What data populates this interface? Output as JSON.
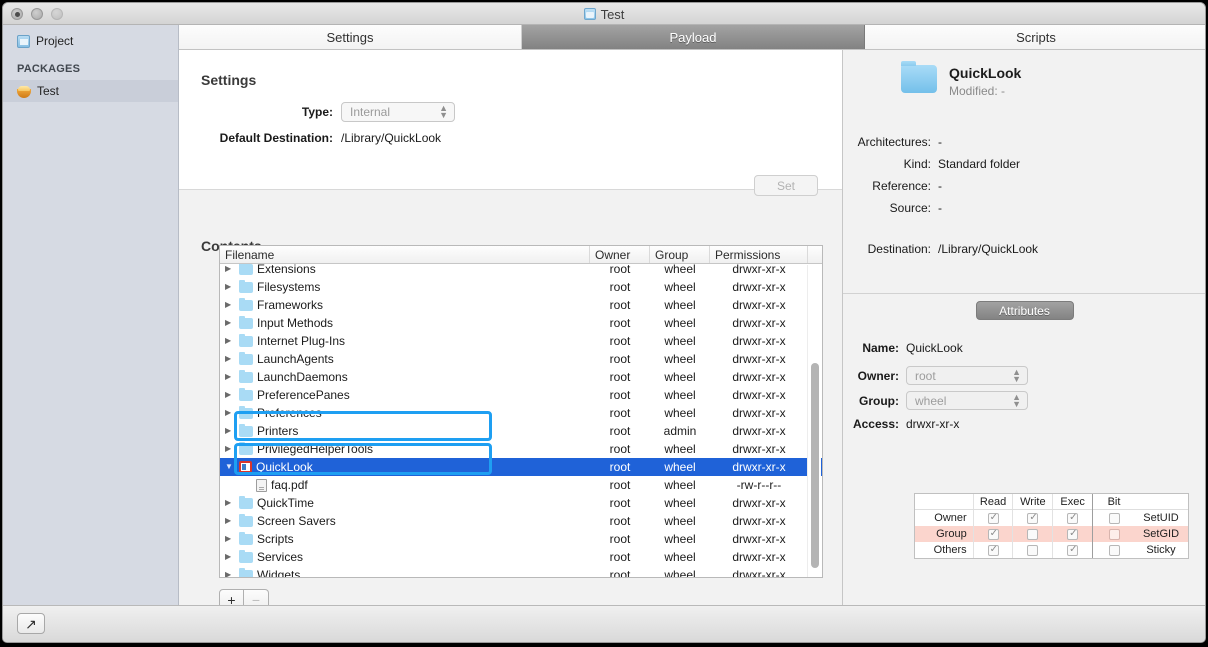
{
  "window": {
    "title": "Test",
    "title_icon": "project-document-icon",
    "controls": [
      "close-button",
      "minimize-button",
      "zoom-button"
    ]
  },
  "sidebar": {
    "items": [
      {
        "label": "Project",
        "icon": "project-icon",
        "selected": false
      },
      {
        "label": "Test",
        "icon": "package-icon",
        "selected": true
      }
    ],
    "section_header": "PACKAGES"
  },
  "tabs": [
    {
      "label": "Settings",
      "active": false
    },
    {
      "label": "Payload",
      "active": true
    },
    {
      "label": "Scripts",
      "active": false
    }
  ],
  "settings": {
    "title": "Settings",
    "type_label": "Type:",
    "type_value": "Internal",
    "destination_label": "Default Destination:",
    "destination_value": "/Library/QuickLook",
    "set_button": "Set"
  },
  "contents": {
    "title": "Contents",
    "columns": [
      "Filename",
      "Owner",
      "Group",
      "Permissions"
    ],
    "add_button": "+",
    "remove_button": "−",
    "rows": [
      {
        "name": "Extensions",
        "owner": "root",
        "group": "wheel",
        "perm": "drwxr-xr-x",
        "icon": "folder-icon",
        "disclosure": "closed",
        "indent": 0,
        "selected": false,
        "clipped": true
      },
      {
        "name": "Filesystems",
        "owner": "root",
        "group": "wheel",
        "perm": "drwxr-xr-x",
        "icon": "folder-icon",
        "disclosure": "closed",
        "indent": 0,
        "selected": false
      },
      {
        "name": "Frameworks",
        "owner": "root",
        "group": "wheel",
        "perm": "drwxr-xr-x",
        "icon": "folder-icon",
        "disclosure": "closed",
        "indent": 0,
        "selected": false
      },
      {
        "name": "Input Methods",
        "owner": "root",
        "group": "wheel",
        "perm": "drwxr-xr-x",
        "icon": "folder-icon",
        "disclosure": "closed",
        "indent": 0,
        "selected": false
      },
      {
        "name": "Internet Plug-Ins",
        "owner": "root",
        "group": "wheel",
        "perm": "drwxr-xr-x",
        "icon": "folder-icon",
        "disclosure": "closed",
        "indent": 0,
        "selected": false
      },
      {
        "name": "LaunchAgents",
        "owner": "root",
        "group": "wheel",
        "perm": "drwxr-xr-x",
        "icon": "folder-icon",
        "disclosure": "closed",
        "indent": 0,
        "selected": false
      },
      {
        "name": "LaunchDaemons",
        "owner": "root",
        "group": "wheel",
        "perm": "drwxr-xr-x",
        "icon": "folder-icon",
        "disclosure": "closed",
        "indent": 0,
        "selected": false
      },
      {
        "name": "PreferencePanes",
        "owner": "root",
        "group": "wheel",
        "perm": "drwxr-xr-x",
        "icon": "folder-icon",
        "disclosure": "closed",
        "indent": 0,
        "selected": false
      },
      {
        "name": "Preferences",
        "owner": "root",
        "group": "wheel",
        "perm": "drwxr-xr-x",
        "icon": "folder-icon",
        "disclosure": "closed",
        "indent": 0,
        "selected": false
      },
      {
        "name": "Printers",
        "owner": "root",
        "group": "admin",
        "perm": "drwxr-xr-x",
        "icon": "folder-icon",
        "disclosure": "closed",
        "indent": 0,
        "selected": false
      },
      {
        "name": "PrivilegedHelperTools",
        "owner": "root",
        "group": "wheel",
        "perm": "drwxr-xr-x",
        "icon": "folder-icon",
        "disclosure": "closed",
        "indent": 0,
        "selected": false
      },
      {
        "name": "QuickLook",
        "owner": "root",
        "group": "wheel",
        "perm": "drwxr-xr-x",
        "icon": "quicklook-icon",
        "disclosure": "open",
        "indent": 0,
        "selected": true
      },
      {
        "name": "faq.pdf",
        "owner": "root",
        "group": "wheel",
        "perm": "-rw-r--r--",
        "icon": "pdf-document-icon",
        "disclosure": "none",
        "indent": 1,
        "selected": false
      },
      {
        "name": "QuickTime",
        "owner": "root",
        "group": "wheel",
        "perm": "drwxr-xr-x",
        "icon": "folder-icon",
        "disclosure": "closed",
        "indent": 0,
        "selected": false
      },
      {
        "name": "Screen Savers",
        "owner": "root",
        "group": "wheel",
        "perm": "drwxr-xr-x",
        "icon": "folder-icon",
        "disclosure": "closed",
        "indent": 0,
        "selected": false
      },
      {
        "name": "Scripts",
        "owner": "root",
        "group": "wheel",
        "perm": "drwxr-xr-x",
        "icon": "folder-icon",
        "disclosure": "closed",
        "indent": 0,
        "selected": false
      },
      {
        "name": "Services",
        "owner": "root",
        "group": "wheel",
        "perm": "drwxr-xr-x",
        "icon": "folder-icon",
        "disclosure": "closed",
        "indent": 0,
        "selected": false
      },
      {
        "name": "Widgets",
        "owner": "root",
        "group": "wheel",
        "perm": "drwxr-xr-x",
        "icon": "folder-icon",
        "disclosure": "closed",
        "indent": 0,
        "selected": false
      }
    ]
  },
  "inspector": {
    "name": "QuickLook",
    "modified_label": "Modified:",
    "modified_value": "-",
    "fields": [
      {
        "label": "Architectures:",
        "value": "-"
      },
      {
        "label": "Kind:",
        "value": "Standard folder"
      },
      {
        "label": "Reference:",
        "value": "-"
      },
      {
        "label": "Source:",
        "value": "-"
      }
    ],
    "destination_label": "Destination:",
    "destination_value": "/Library/QuickLook",
    "segment": "Attributes",
    "attributes": {
      "name_label": "Name:",
      "name_value": "QuickLook",
      "owner_label": "Owner:",
      "owner_value": "root",
      "group_label": "Group:",
      "group_value": "wheel",
      "access_label": "Access:",
      "access_value": "drwxr-xr-x",
      "perm_headers": [
        "Read",
        "Write",
        "Exec"
      ],
      "bit_header": "Bit",
      "perm_rows": [
        {
          "name": "Owner",
          "read": true,
          "write": true,
          "exec": true
        },
        {
          "name": "Group",
          "read": true,
          "write": false,
          "exec": true
        },
        {
          "name": "Others",
          "read": true,
          "write": false,
          "exec": true
        }
      ],
      "bit_rows": [
        {
          "name": "SetUID",
          "checked": false,
          "highlighted": false
        },
        {
          "name": "SetGID",
          "checked": false,
          "highlighted": true
        },
        {
          "name": "Sticky",
          "checked": false,
          "highlighted": false
        }
      ]
    }
  },
  "toolbar": {
    "export_icon": "↗"
  },
  "annotations": {
    "accent_color": "#1e9ff2",
    "boxes": [
      {
        "label": "privilegedhelpertools-quicklook-highlight"
      },
      {
        "label": "quicklook-faq-highlight"
      }
    ]
  }
}
